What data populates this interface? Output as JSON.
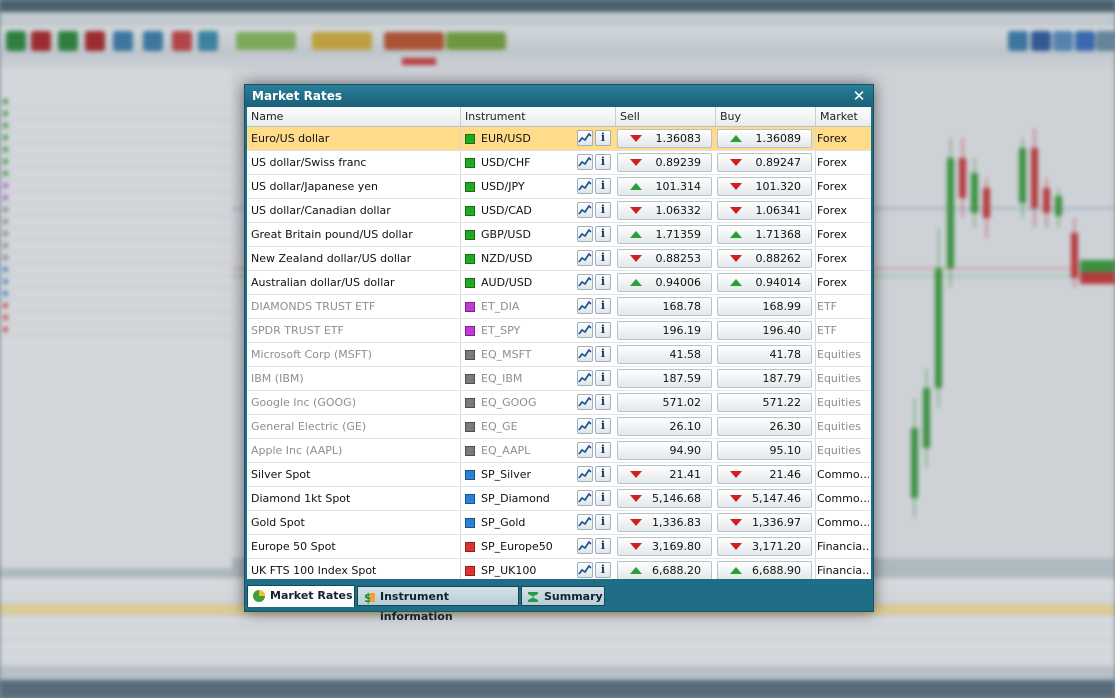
{
  "dialog": {
    "title": "Market Rates",
    "close_glyph": "✕"
  },
  "columns": {
    "name": "Name",
    "instrument": "Instrument",
    "sell": "Sell",
    "buy": "Buy",
    "market": "Market"
  },
  "info_glyph": "i",
  "rows": [
    {
      "name": "Euro/US dollar",
      "instrument": "EUR/USD",
      "color": "#1faa1f",
      "sell": "1.36083",
      "sell_dir": "down",
      "buy": "1.36089",
      "buy_dir": "up",
      "market": "Forex",
      "selected": true,
      "muted": false
    },
    {
      "name": "US dollar/Swiss franc",
      "instrument": "USD/CHF",
      "color": "#1faa1f",
      "sell": "0.89239",
      "sell_dir": "down",
      "buy": "0.89247",
      "buy_dir": "down",
      "market": "Forex",
      "selected": false,
      "muted": false
    },
    {
      "name": "US dollar/Japanese yen",
      "instrument": "USD/JPY",
      "color": "#1faa1f",
      "sell": "101.314",
      "sell_dir": "up",
      "buy": "101.320",
      "buy_dir": "down",
      "market": "Forex",
      "selected": false,
      "muted": false
    },
    {
      "name": "US dollar/Canadian dollar",
      "instrument": "USD/CAD",
      "color": "#1faa1f",
      "sell": "1.06332",
      "sell_dir": "down",
      "buy": "1.06341",
      "buy_dir": "down",
      "market": "Forex",
      "selected": false,
      "muted": false
    },
    {
      "name": "Great Britain pound/US dollar",
      "instrument": "GBP/USD",
      "color": "#1faa1f",
      "sell": "1.71359",
      "sell_dir": "up",
      "buy": "1.71368",
      "buy_dir": "up",
      "market": "Forex",
      "selected": false,
      "muted": false
    },
    {
      "name": "New Zealand dollar/US dollar",
      "instrument": "NZD/USD",
      "color": "#1faa1f",
      "sell": "0.88253",
      "sell_dir": "down",
      "buy": "0.88262",
      "buy_dir": "down",
      "market": "Forex",
      "selected": false,
      "muted": false
    },
    {
      "name": "Australian dollar/US dollar",
      "instrument": "AUD/USD",
      "color": "#1faa1f",
      "sell": "0.94006",
      "sell_dir": "up",
      "buy": "0.94014",
      "buy_dir": "up",
      "market": "Forex",
      "selected": false,
      "muted": false
    },
    {
      "name": "DIAMONDS TRUST ETF",
      "instrument": "ET_DIA",
      "color": "#c23ad6",
      "sell": "168.78",
      "sell_dir": "none",
      "buy": "168.99",
      "buy_dir": "none",
      "market": "ETF",
      "selected": false,
      "muted": true
    },
    {
      "name": "SPDR TRUST ETF",
      "instrument": "ET_SPY",
      "color": "#c23ad6",
      "sell": "196.19",
      "sell_dir": "none",
      "buy": "196.40",
      "buy_dir": "none",
      "market": "ETF",
      "selected": false,
      "muted": true
    },
    {
      "name": "Microsoft Corp (MSFT)",
      "instrument": "EQ_MSFT",
      "color": "#7a7a7a",
      "sell": "41.58",
      "sell_dir": "none",
      "buy": "41.78",
      "buy_dir": "none",
      "market": "Equities",
      "selected": false,
      "muted": true
    },
    {
      "name": "IBM (IBM)",
      "instrument": "EQ_IBM",
      "color": "#7a7a7a",
      "sell": "187.59",
      "sell_dir": "none",
      "buy": "187.79",
      "buy_dir": "none",
      "market": "Equities",
      "selected": false,
      "muted": true
    },
    {
      "name": "Google Inc (GOOG)",
      "instrument": "EQ_GOOG",
      "color": "#7a7a7a",
      "sell": "571.02",
      "sell_dir": "none",
      "buy": "571.22",
      "buy_dir": "none",
      "market": "Equities",
      "selected": false,
      "muted": true
    },
    {
      "name": "General Electric (GE)",
      "instrument": "EQ_GE",
      "color": "#7a7a7a",
      "sell": "26.10",
      "sell_dir": "none",
      "buy": "26.30",
      "buy_dir": "none",
      "market": "Equities",
      "selected": false,
      "muted": true
    },
    {
      "name": "Apple Inc (AAPL)",
      "instrument": "EQ_AAPL",
      "color": "#7a7a7a",
      "sell": "94.90",
      "sell_dir": "none",
      "buy": "95.10",
      "buy_dir": "none",
      "market": "Equities",
      "selected": false,
      "muted": true
    },
    {
      "name": "Silver Spot",
      "instrument": "SP_Silver",
      "color": "#2a7fd6",
      "sell": "21.41",
      "sell_dir": "down",
      "buy": "21.46",
      "buy_dir": "down",
      "market": "Commo…",
      "selected": false,
      "muted": false
    },
    {
      "name": "Diamond 1kt Spot",
      "instrument": "SP_Diamond",
      "color": "#2a7fd6",
      "sell": "5,146.68",
      "sell_dir": "down",
      "buy": "5,147.46",
      "buy_dir": "down",
      "market": "Commo…",
      "selected": false,
      "muted": false
    },
    {
      "name": "Gold Spot",
      "instrument": "SP_Gold",
      "color": "#2a7fd6",
      "sell": "1,336.83",
      "sell_dir": "down",
      "buy": "1,336.97",
      "buy_dir": "down",
      "market": "Commo…",
      "selected": false,
      "muted": false
    },
    {
      "name": "Europe 50 Spot",
      "instrument": "SP_Europe50",
      "color": "#e03030",
      "sell": "3,169.80",
      "sell_dir": "down",
      "buy": "3,171.20",
      "buy_dir": "down",
      "market": "Financia…",
      "selected": false,
      "muted": false
    },
    {
      "name": "UK FTS 100 Index Spot",
      "instrument": "SP_UK100",
      "color": "#e03030",
      "sell": "6,688.20",
      "sell_dir": "up",
      "buy": "6,688.90",
      "buy_dir": "up",
      "market": "Financia…",
      "selected": false,
      "muted": false
    }
  ],
  "tabs": [
    {
      "label": "Market Rates",
      "icon": "market-rates-icon",
      "active": true
    },
    {
      "label": "Instrument information",
      "icon": "instrument-information-icon",
      "active": false
    },
    {
      "label": "Summary",
      "icon": "summary-icon",
      "active": false
    }
  ],
  "colors": {
    "dialog_frame": "#1f6e86",
    "selected_row": "#ffdb8a",
    "down_arrow": "#d01f1f",
    "up_arrow": "#2aa034"
  }
}
